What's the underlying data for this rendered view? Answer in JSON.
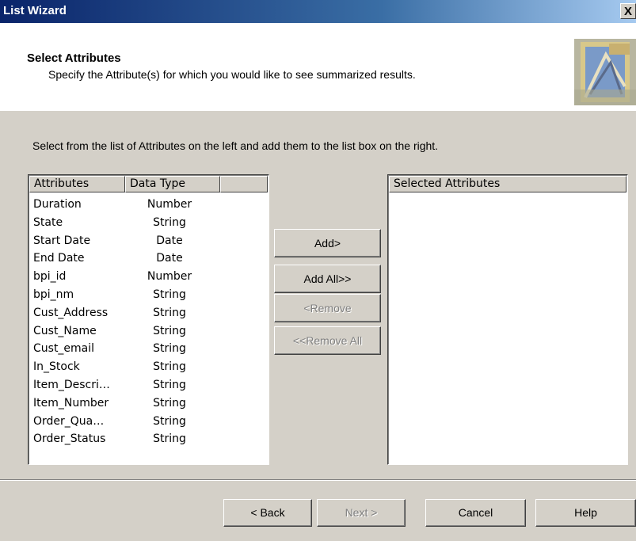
{
  "window": {
    "title": "List Wizard",
    "close_label": "X"
  },
  "header": {
    "title": "Select Attributes",
    "subtitle": "Specify the Attribute(s) for which you would like to see summarized results."
  },
  "instruction": "Select from the list of Attributes on the left and add them to the list box on the right.",
  "attributes_list": {
    "col_attributes": "Attributes",
    "col_data_type": "Data Type",
    "rows": [
      {
        "name": "Duration",
        "type": "Number"
      },
      {
        "name": "State",
        "type": "String"
      },
      {
        "name": "Start Date",
        "type": "Date"
      },
      {
        "name": "End Date",
        "type": "Date"
      },
      {
        "name": "bpi_id",
        "type": "Number"
      },
      {
        "name": "bpi_nm",
        "type": "String"
      },
      {
        "name": "Cust_Address",
        "type": "String"
      },
      {
        "name": "Cust_Name",
        "type": "String"
      },
      {
        "name": "Cust_email",
        "type": "String"
      },
      {
        "name": "In_Stock",
        "type": "String"
      },
      {
        "name": "Item_Descri…",
        "type": "String"
      },
      {
        "name": "Item_Number",
        "type": "String"
      },
      {
        "name": "Order_Qua…",
        "type": "String"
      },
      {
        "name": "Order_Status",
        "type": "String"
      }
    ]
  },
  "selected_list": {
    "col_header": "Selected Attributes"
  },
  "actions": {
    "add": "Add>",
    "add_all": "Add All>>",
    "remove": "<Remove",
    "remove_all": "<<Remove All"
  },
  "footer": {
    "back": "< Back",
    "next": "Next >",
    "cancel": "Cancel",
    "help": "Help"
  }
}
